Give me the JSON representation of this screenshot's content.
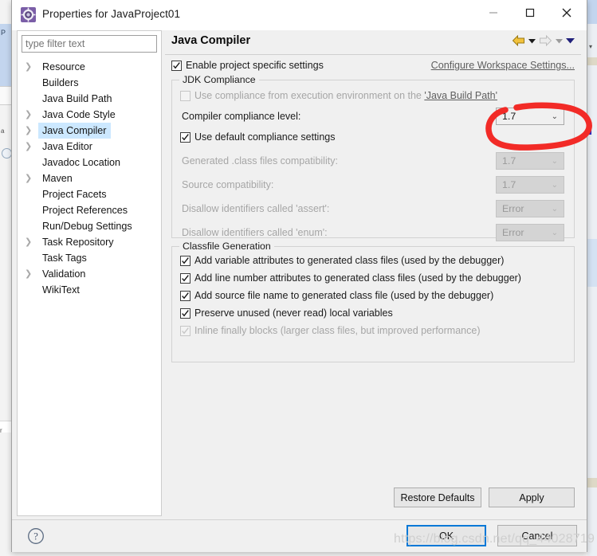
{
  "window": {
    "title": "Properties for JavaProject01",
    "icon": "eclipse-properties-gear-icon",
    "minimize_label": "—",
    "maximize_label": "□",
    "close_label": "✕"
  },
  "sidebar": {
    "filter_placeholder": "type filter text",
    "filter_value": "",
    "items": [
      {
        "label": "Resource",
        "expandable": true,
        "selected": false
      },
      {
        "label": "Builders",
        "expandable": false,
        "selected": false
      },
      {
        "label": "Java Build Path",
        "expandable": false,
        "selected": false
      },
      {
        "label": "Java Code Style",
        "expandable": true,
        "selected": false
      },
      {
        "label": "Java Compiler",
        "expandable": true,
        "selected": true
      },
      {
        "label": "Java Editor",
        "expandable": true,
        "selected": false
      },
      {
        "label": "Javadoc Location",
        "expandable": false,
        "selected": false
      },
      {
        "label": "Maven",
        "expandable": true,
        "selected": false
      },
      {
        "label": "Project Facets",
        "expandable": false,
        "selected": false
      },
      {
        "label": "Project References",
        "expandable": false,
        "selected": false
      },
      {
        "label": "Run/Debug Settings",
        "expandable": false,
        "selected": false
      },
      {
        "label": "Task Repository",
        "expandable": true,
        "selected": false
      },
      {
        "label": "Task Tags",
        "expandable": false,
        "selected": false
      },
      {
        "label": "Validation",
        "expandable": true,
        "selected": false
      },
      {
        "label": "WikiText",
        "expandable": false,
        "selected": false
      }
    ]
  },
  "page": {
    "title": "Java Compiler",
    "nav": {
      "back_icon": "back-arrow-icon",
      "back_menu_icon": "chevron-down-icon",
      "forward_icon": "forward-arrow-icon",
      "forward_menu_icon": "chevron-down-icon",
      "view_menu_icon": "chevron-down-icon"
    },
    "enable_project_specific": {
      "label": "Enable project specific settings",
      "checked": true
    },
    "configure_workspace_link": "Configure Workspace Settings...",
    "jdk_compliance": {
      "legend": "JDK Compliance",
      "use_execution_environment": {
        "label_prefix": "Use compliance from execution environment on the ",
        "label_link": "'Java Build Path'",
        "checked": false,
        "enabled": false
      },
      "compiler_compliance_level": {
        "label": "Compiler compliance level:",
        "value": "1.7",
        "enabled": true
      },
      "use_default_compliance": {
        "label": "Use default compliance settings",
        "checked": true
      },
      "generated_class_files_compatibility": {
        "label": "Generated .class files compatibility:",
        "value": "1.7",
        "enabled": false
      },
      "source_compatibility": {
        "label": "Source compatibility:",
        "value": "1.7",
        "enabled": false
      },
      "disallow_assert": {
        "label": "Disallow identifiers called 'assert':",
        "value": "Error",
        "enabled": false
      },
      "disallow_enum": {
        "label": "Disallow identifiers called 'enum':",
        "value": "Error",
        "enabled": false
      }
    },
    "classfile_generation": {
      "legend": "Classfile Generation",
      "options": [
        {
          "label": "Add variable attributes to generated class files (used by the debugger)",
          "checked": true,
          "enabled": true
        },
        {
          "label": "Add line number attributes to generated class files (used by the debugger)",
          "checked": true,
          "enabled": true
        },
        {
          "label": "Add source file name to generated class file (used by the debugger)",
          "checked": true,
          "enabled": true
        },
        {
          "label": "Preserve unused (never read) local variables",
          "checked": true,
          "enabled": true
        },
        {
          "label": "Inline finally blocks (larger class files, but improved performance)",
          "checked": true,
          "enabled": false
        }
      ]
    },
    "restore_defaults_label": "Restore Defaults",
    "apply_label": "Apply"
  },
  "footer": {
    "help_icon": "help-question-icon",
    "ok_label": "OK",
    "cancel_label": "Cancel"
  },
  "annotation": {
    "type": "hand-drawn-red-circle",
    "color": "#f22b27",
    "target": "compiler-compliance-level-combo"
  },
  "watermark": "https://blog.csdn.net/qq_44028719",
  "colors": {
    "selection_blue": "#cce8ff",
    "focus_border_blue": "#0078d7",
    "dialog_bg": "#f0f0f0",
    "disabled_text": "#a6a6a6",
    "annotation_red": "#f22b27"
  }
}
